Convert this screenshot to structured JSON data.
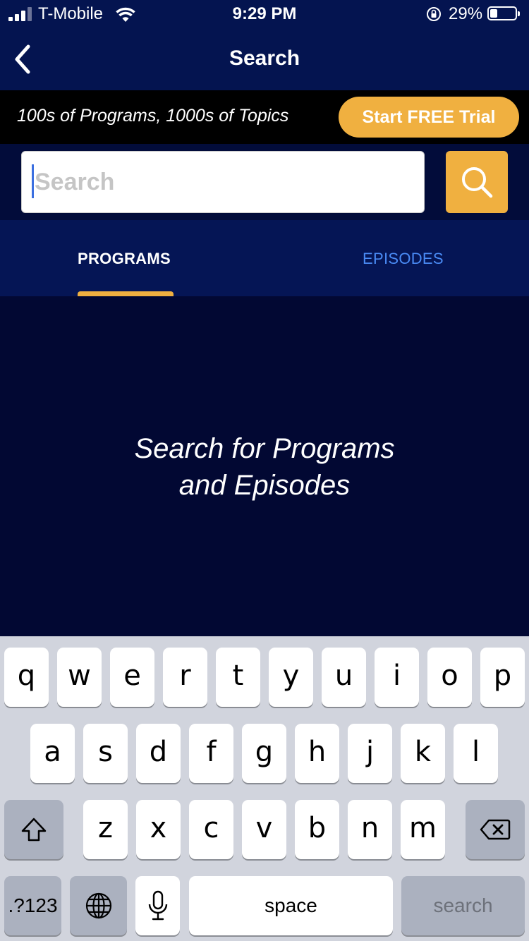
{
  "status_bar": {
    "carrier": "T-Mobile",
    "time": "9:29 PM",
    "battery": "29%",
    "battery_level": 0.29
  },
  "nav": {
    "title": "Search",
    "back_icon": "chevron-left-icon"
  },
  "promo": {
    "text": "100s of Programs, 1000s of Topics",
    "button_label": "Start FREE Trial"
  },
  "search": {
    "placeholder": "Search",
    "value": "",
    "button_icon": "search-icon"
  },
  "tabs": [
    {
      "label": "PROGRAMS",
      "active": true
    },
    {
      "label": "EPISODES",
      "active": false
    }
  ],
  "empty_state": {
    "line1": "Search for Programs",
    "line2": "and Episodes"
  },
  "keyboard": {
    "row1": [
      "q",
      "w",
      "e",
      "r",
      "t",
      "y",
      "u",
      "i",
      "o",
      "p"
    ],
    "row2": [
      "a",
      "s",
      "d",
      "f",
      "g",
      "h",
      "j",
      "k",
      "l"
    ],
    "row3": [
      "z",
      "x",
      "c",
      "v",
      "b",
      "n",
      "m"
    ],
    "numbers_label": ".?123",
    "space_label": "space",
    "search_label": "search"
  },
  "colors": {
    "accent": "#F0B040",
    "header_bg": "#041450",
    "background": "#020833",
    "tab_inactive": "#4a8bf5"
  }
}
